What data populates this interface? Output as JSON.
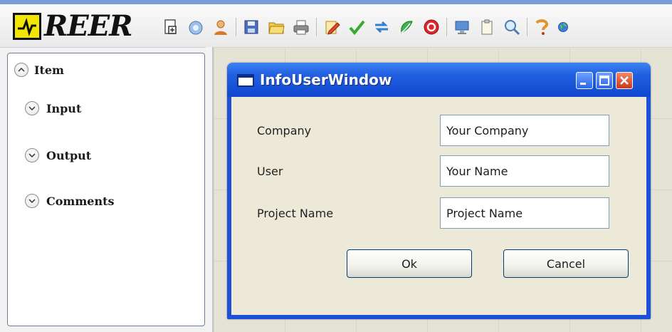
{
  "app": {
    "logo_text": "REER",
    "colors": {
      "logo_yellow": "#f2e600",
      "titlebar_blue": "#1c50d6",
      "design_bg": "#e4e3d6"
    }
  },
  "toolbar": {
    "icons": [
      "new-document-icon",
      "open-project-icon",
      "user-info-icon",
      "save-icon",
      "open-folder-icon",
      "print-icon",
      "edit-pencil-icon",
      "validate-check-icon",
      "connect-arrows-icon",
      "refresh-icon",
      "stop-icon",
      "monitor-icon",
      "clipboard-icon",
      "zoom-icon",
      "help-icon",
      "globe-icon"
    ]
  },
  "left_panel": {
    "items": [
      {
        "label": "Item",
        "state": "expanded"
      },
      {
        "label": "Input",
        "state": "collapsed"
      },
      {
        "label": "Output",
        "state": "collapsed"
      },
      {
        "label": "Comments",
        "state": "collapsed"
      }
    ]
  },
  "dialog": {
    "title": "InfoUserWindow",
    "fields": [
      {
        "label": "Company",
        "value": "Your Company"
      },
      {
        "label": "User",
        "value": "Your Name"
      },
      {
        "label": "Project Name",
        "value": "Project Name"
      }
    ],
    "ok_label": "Ok",
    "cancel_label": "Cancel"
  }
}
